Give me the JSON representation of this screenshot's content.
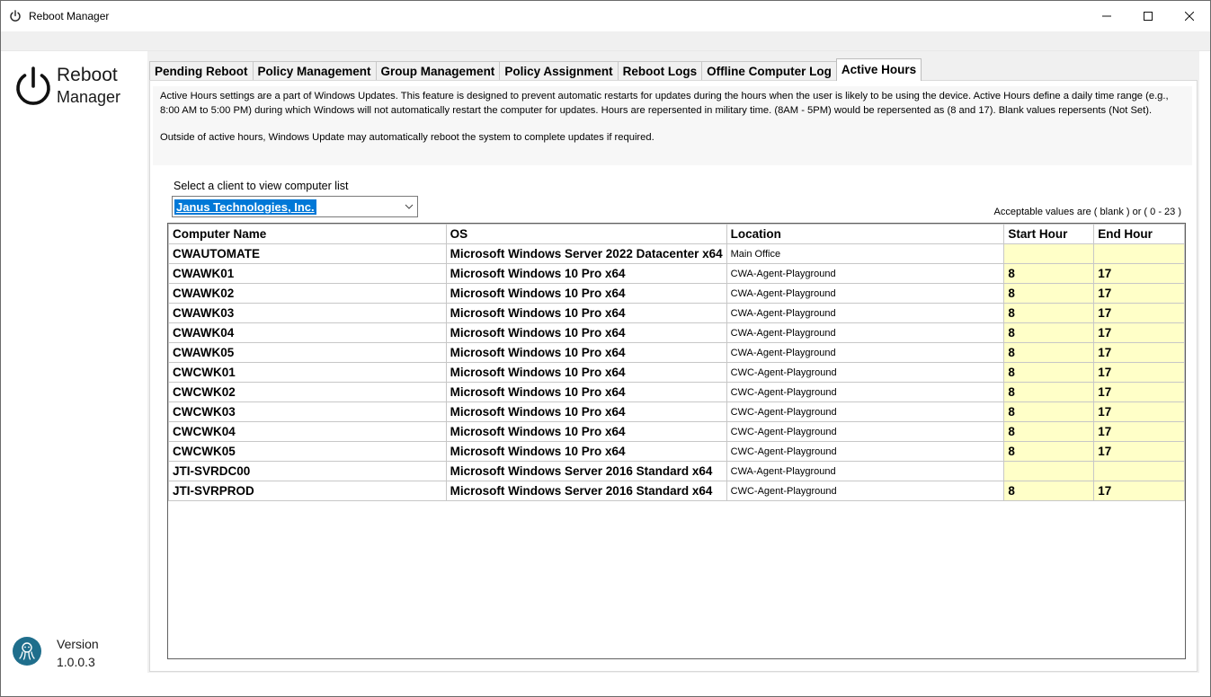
{
  "window": {
    "title": "Reboot Manager"
  },
  "sidebar": {
    "logo_line1": "Reboot",
    "logo_line2": "Manager",
    "version_label": "Version",
    "version_number": "1.0.0.3"
  },
  "tabs": [
    {
      "label": "Pending Reboot",
      "active": false
    },
    {
      "label": "Policy Management",
      "active": false
    },
    {
      "label": "Group Management",
      "active": false
    },
    {
      "label": "Policy Assignment",
      "active": false
    },
    {
      "label": "Reboot Logs",
      "active": false
    },
    {
      "label": "Offline Computer Log",
      "active": false
    },
    {
      "label": "Active Hours",
      "active": true
    }
  ],
  "info": {
    "paragraph1": "Active Hours settings are a part of Windows Updates. This feature is designed to prevent automatic restarts for updates during the hours when the user is likely to be using the device. Active Hours define a daily time range (e.g., 8:00 AM to 5:00 PM) during which Windows will not automatically restart the computer for updates. Hours are repersented in military time. (8AM - 5PM) would be repersented as (8 and 17). Blank values repersents (Not Set).",
    "paragraph2": "Outside of active hours, Windows Update may automatically reboot the system to complete updates if required."
  },
  "client": {
    "label": "Select a client to view computer list",
    "selected": "Janus Technologies, Inc."
  },
  "acceptable_note": "Acceptable values are ( blank ) or ( 0 - 23 )",
  "grid": {
    "columns": [
      "Computer Name",
      "OS",
      "Location",
      "Start Hour",
      "End Hour"
    ],
    "rows": [
      {
        "name": "CWAUTOMATE",
        "os": "Microsoft Windows Server 2022 Datacenter x64",
        "location": "Main Office",
        "start": "",
        "end": ""
      },
      {
        "name": "CWAWK01",
        "os": "Microsoft Windows 10 Pro x64",
        "location": "CWA-Agent-Playground",
        "start": "8",
        "end": "17"
      },
      {
        "name": "CWAWK02",
        "os": "Microsoft Windows 10 Pro x64",
        "location": "CWA-Agent-Playground",
        "start": "8",
        "end": "17"
      },
      {
        "name": "CWAWK03",
        "os": "Microsoft Windows 10 Pro x64",
        "location": "CWA-Agent-Playground",
        "start": "8",
        "end": "17"
      },
      {
        "name": "CWAWK04",
        "os": "Microsoft Windows 10 Pro x64",
        "location": "CWA-Agent-Playground",
        "start": "8",
        "end": "17"
      },
      {
        "name": "CWAWK05",
        "os": "Microsoft Windows 10 Pro x64",
        "location": "CWA-Agent-Playground",
        "start": "8",
        "end": "17"
      },
      {
        "name": "CWCWK01",
        "os": "Microsoft Windows 10 Pro x64",
        "location": "CWC-Agent-Playground",
        "start": "8",
        "end": "17"
      },
      {
        "name": "CWCWK02",
        "os": "Microsoft Windows 10 Pro x64",
        "location": "CWC-Agent-Playground",
        "start": "8",
        "end": "17"
      },
      {
        "name": "CWCWK03",
        "os": "Microsoft Windows 10 Pro x64",
        "location": "CWC-Agent-Playground",
        "start": "8",
        "end": "17"
      },
      {
        "name": "CWCWK04",
        "os": "Microsoft Windows 10 Pro x64",
        "location": "CWC-Agent-Playground",
        "start": "8",
        "end": "17"
      },
      {
        "name": "CWCWK05",
        "os": "Microsoft Windows 10 Pro x64",
        "location": "CWC-Agent-Playground",
        "start": "8",
        "end": "17"
      },
      {
        "name": "JTI-SVRDC00",
        "os": "Microsoft Windows Server 2016 Standard x64",
        "location": "CWA-Agent-Playground",
        "start": "",
        "end": ""
      },
      {
        "name": "JTI-SVRPROD",
        "os": "Microsoft Windows Server 2016 Standard x64",
        "location": "CWC-Agent-Playground",
        "start": "8",
        "end": "17"
      }
    ]
  },
  "colors": {
    "hour_cell_bg": "#ffffc8",
    "selection_blue": "#0078d7",
    "logo_teal": "#1f6e8c"
  }
}
